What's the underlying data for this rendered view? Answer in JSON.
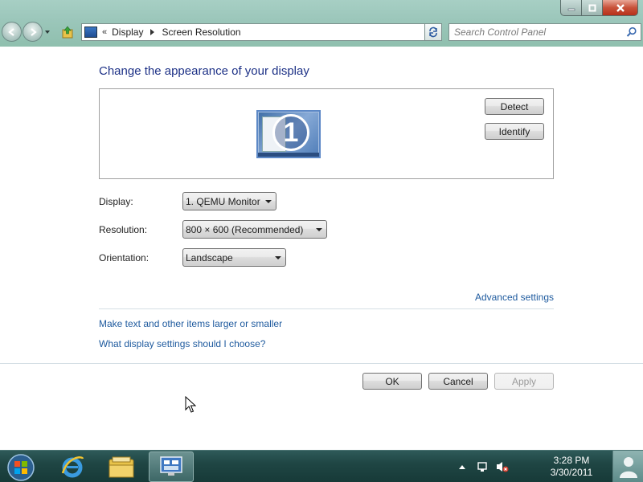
{
  "window": {
    "caption_buttons": {
      "minimize_icon": "minimize-icon",
      "maximize_icon": "maximize-icon",
      "close_icon": "close-icon"
    }
  },
  "navigation": {
    "breadcrumbs": [
      "Display",
      "Screen Resolution"
    ],
    "overflow_chevron": "«"
  },
  "search": {
    "placeholder": "Search Control Panel"
  },
  "page": {
    "title": "Change the appearance of your display",
    "detect_label": "Detect",
    "identify_label": "Identify",
    "monitor_number": "1"
  },
  "fields": {
    "display": {
      "label": "Display:",
      "value": "1. QEMU Monitor"
    },
    "resolution": {
      "label": "Resolution:",
      "value": "800 × 600 (Recommended)"
    },
    "orientation": {
      "label": "Orientation:",
      "value": "Landscape"
    }
  },
  "links": {
    "advanced": "Advanced settings",
    "text_size": "Make text and other items larger or smaller",
    "help": "What display settings should I choose?"
  },
  "dialog_buttons": {
    "ok": "OK",
    "cancel": "Cancel",
    "apply": "Apply"
  },
  "taskbar": {
    "time": "3:28 PM",
    "date": "3/30/2011",
    "pinned": [
      "internet-explorer-icon",
      "windows-explorer-icon",
      "display-control-panel-icon"
    ]
  },
  "colors": {
    "link": "#1e5a9e",
    "title": "#1e3287",
    "taskbar": "#1f4644"
  }
}
